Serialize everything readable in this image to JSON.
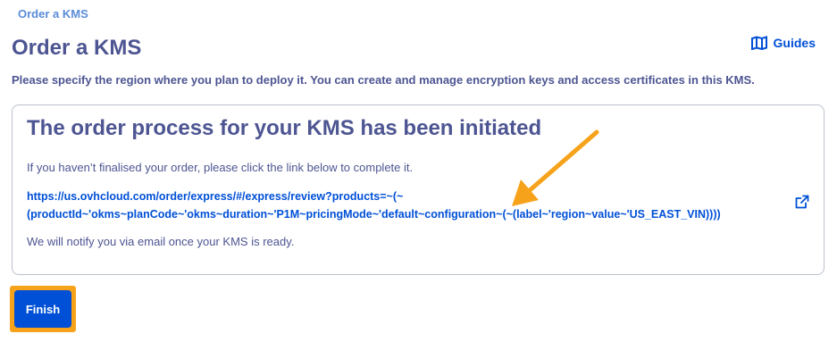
{
  "breadcrumb": {
    "label": "Order a KMS"
  },
  "header": {
    "title": "Order a KMS",
    "guides_label": "Guides",
    "description": "Please specify the region where you plan to deploy it. You can create and manage encryption keys and access certificates in this KMS."
  },
  "card": {
    "title": "The order process for your KMS has been initiated",
    "instruction": "If you haven’t finalised your order, please click the link below to complete it.",
    "link_line1": "https://us.ovhcloud.com/order/express/#/express/review?products=~(~",
    "link_line2": "(productId~'okms~planCode~'okms~duration~'P1M~pricingMode~'default~configuration~(~(label~'region~value~'US_EAST_VIN))))",
    "notice": "We will notify you via email once your KMS is ready."
  },
  "actions": {
    "finish_label": "Finish"
  },
  "icons": {
    "guides": "book-icon",
    "external": "external-link-icon"
  },
  "colors": {
    "primary": "#0050d7",
    "text": "#4d5592",
    "breadcrumb": "#5a8cd8",
    "highlight": "#f7a21b",
    "card_border": "#bbc1cc"
  }
}
